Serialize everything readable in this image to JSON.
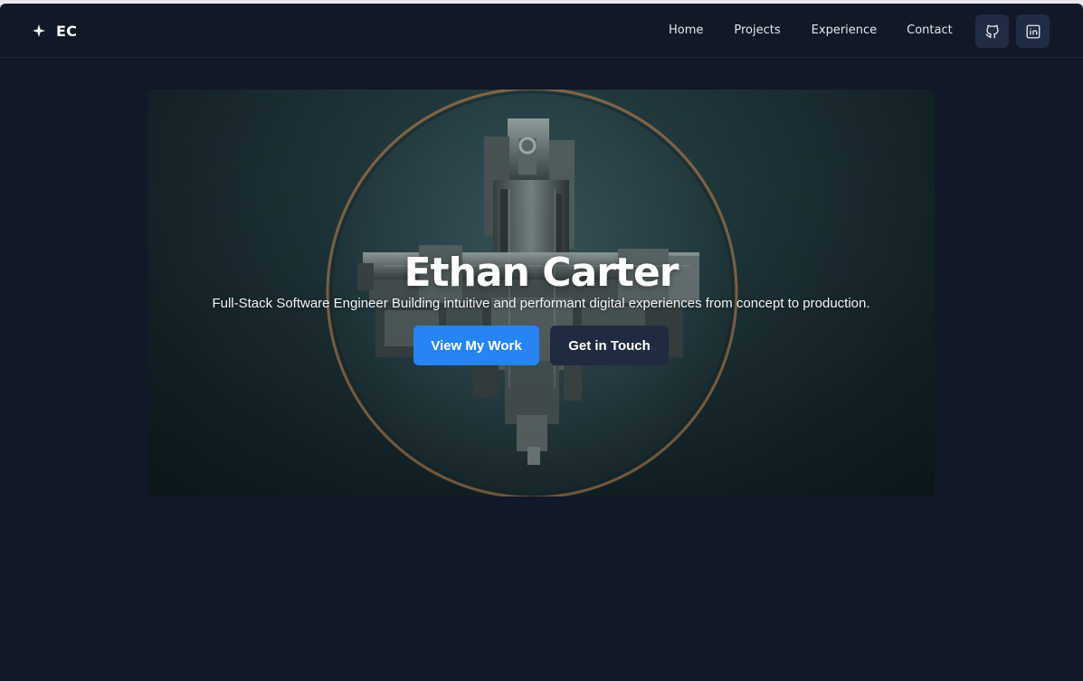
{
  "brand": {
    "icon": "sparkle-icon",
    "initials": "EC"
  },
  "nav": {
    "items": [
      {
        "label": "Home"
      },
      {
        "label": "Projects"
      },
      {
        "label": "Experience"
      },
      {
        "label": "Contact"
      }
    ],
    "social": [
      {
        "icon": "github-icon"
      },
      {
        "icon": "linkedin-icon"
      }
    ]
  },
  "hero": {
    "title": "Ethan Carter",
    "subtitle": "Full-Stack Software Engineer Building intuitive and performant digital experiences from concept to production.",
    "primary_button": "View My Work",
    "secondary_button": "Get in Touch"
  },
  "colors": {
    "background": "#111827",
    "accent": "#2684f5",
    "secondary_button": "#1e2b40",
    "icon_button": "#1f2d44"
  }
}
